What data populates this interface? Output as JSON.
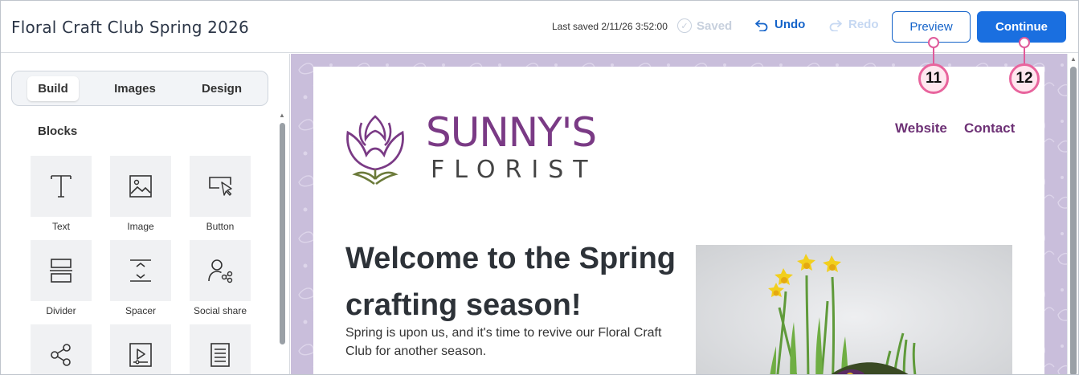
{
  "header": {
    "doc_title": "Floral Craft Club Spring 2026",
    "last_saved": "Last saved 2/11/26 3:52:00",
    "saved_label": "Saved",
    "undo_label": "Undo",
    "redo_label": "Redo",
    "preview_label": "Preview",
    "continue_label": "Continue"
  },
  "callouts": [
    {
      "number": "11"
    },
    {
      "number": "12"
    }
  ],
  "left_panel": {
    "tabs": [
      {
        "label": "Build",
        "active": true
      },
      {
        "label": "Images",
        "active": false
      },
      {
        "label": "Design",
        "active": false
      }
    ],
    "blocks_heading": "Blocks",
    "blocks": [
      {
        "label": "Text",
        "icon": "text-icon"
      },
      {
        "label": "Image",
        "icon": "image-icon"
      },
      {
        "label": "Button",
        "icon": "button-icon"
      },
      {
        "label": "Divider",
        "icon": "divider-icon"
      },
      {
        "label": "Spacer",
        "icon": "spacer-icon"
      },
      {
        "label": "Social share",
        "icon": "social-share-icon"
      },
      {
        "label": "",
        "icon": "share-icon"
      },
      {
        "label": "",
        "icon": "video-icon"
      },
      {
        "label": "",
        "icon": "document-icon"
      }
    ]
  },
  "email": {
    "brand_name": "SUNNY'S",
    "brand_sub": "FLORIST",
    "nav": [
      "Website",
      "Contact"
    ],
    "headline": "Welcome to the Spring crafting season!",
    "body": "Spring is upon us, and it's time to revive our Floral Craft Club for another season."
  },
  "colors": {
    "primary": "#1a6fe0",
    "brand_purple": "#7a3a85",
    "canvas_bg": "#c9bedb",
    "callout": "#e8649d"
  }
}
